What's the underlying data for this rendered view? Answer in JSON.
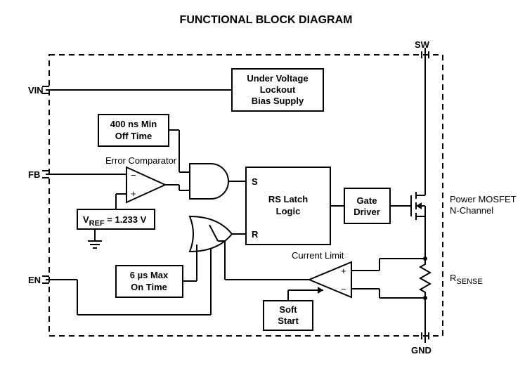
{
  "title": "FUNCTIONAL BLOCK DIAGRAM",
  "pins": {
    "vin": "VIN",
    "fb": "FB",
    "en": "EN",
    "sw": "SW",
    "gnd": "GND"
  },
  "blocks": {
    "uvlo_l1": "Under Voltage",
    "uvlo_l2": "Lockout",
    "uvlo_l3": "Bias Supply",
    "off_time_l1": "400 ns Min",
    "off_time_l2": "Off Time",
    "error_comp": "Error Comparator",
    "vref_pre": "V",
    "vref_sub": "REF",
    "vref_eq": " = 1.233 V",
    "latch_l1": "RS Latch",
    "latch_l2": "Logic",
    "latch_s": "S",
    "latch_r": "R",
    "gate_l1": "Gate",
    "gate_l2": "Driver",
    "on_time_l1": "6 µs Max",
    "on_time_l2": "On Time",
    "current_limit": "Current Limit",
    "soft_l1": "Soft",
    "soft_l2": "Start",
    "mosfet_l1": "Power MOSFET",
    "mosfet_l2": "N-Channel",
    "rsense_pre": "R",
    "rsense_sub": "SENSE",
    "comp_plus": "+",
    "comp_minus": "−"
  }
}
